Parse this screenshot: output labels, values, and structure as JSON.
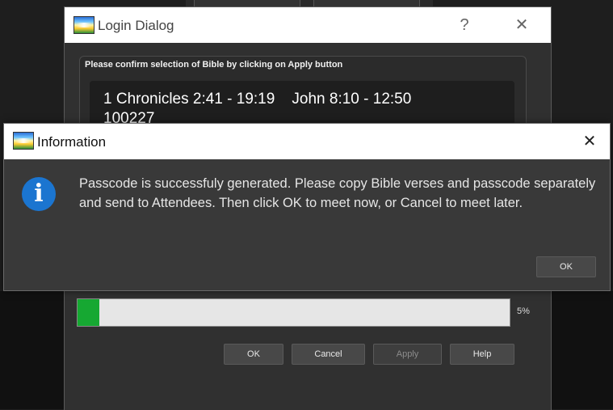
{
  "login_dialog": {
    "title": "Login Dialog",
    "help_glyph": "?",
    "close_glyph": "✕",
    "group_label": "Please confirm selection of Bible by clicking on Apply button",
    "verses_line": "1 Chronicles 2:41 - 19:19    John 8:10 - 12:50",
    "passcode": "100227",
    "progress": {
      "percent": 5,
      "label": "5%"
    },
    "buttons": {
      "ok": "OK",
      "cancel": "Cancel",
      "apply": "Apply",
      "help": "Help"
    }
  },
  "info_dialog": {
    "title": "Information",
    "close_glyph": "✕",
    "icon_glyph": "i",
    "message": "Passcode is successfuly generated. Please copy Bible verses and passcode separately and send to Attendees. Then click OK to meet now, or Cancel to meet later.",
    "ok_label": "OK"
  },
  "colors": {
    "progress_fill": "#16a832",
    "info_icon": "#1b75d0",
    "dialog_body": "#303030"
  }
}
